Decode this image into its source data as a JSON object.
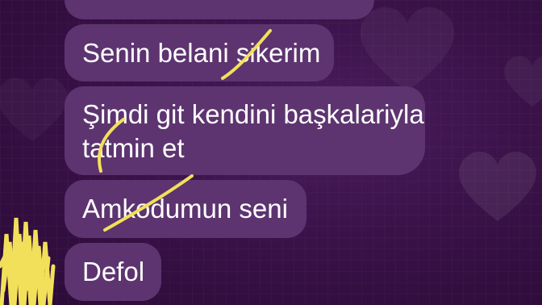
{
  "chat": {
    "messages": [
      {
        "text": ""
      },
      {
        "text": "Senin belani sikerim"
      },
      {
        "lines": [
          "Şimdi git kendini başkalariyla",
          "tatmin et"
        ]
      },
      {
        "text": "Amkodumun seni"
      },
      {
        "text": "Defol"
      }
    ]
  },
  "colors": {
    "background": "#3a1249",
    "bubble": "#5d3470",
    "text": "#ffffff",
    "scribble": "#f2e05a"
  },
  "decorations": [
    "heart-icon",
    "heart-icon",
    "heart-icon",
    "heart-icon"
  ]
}
